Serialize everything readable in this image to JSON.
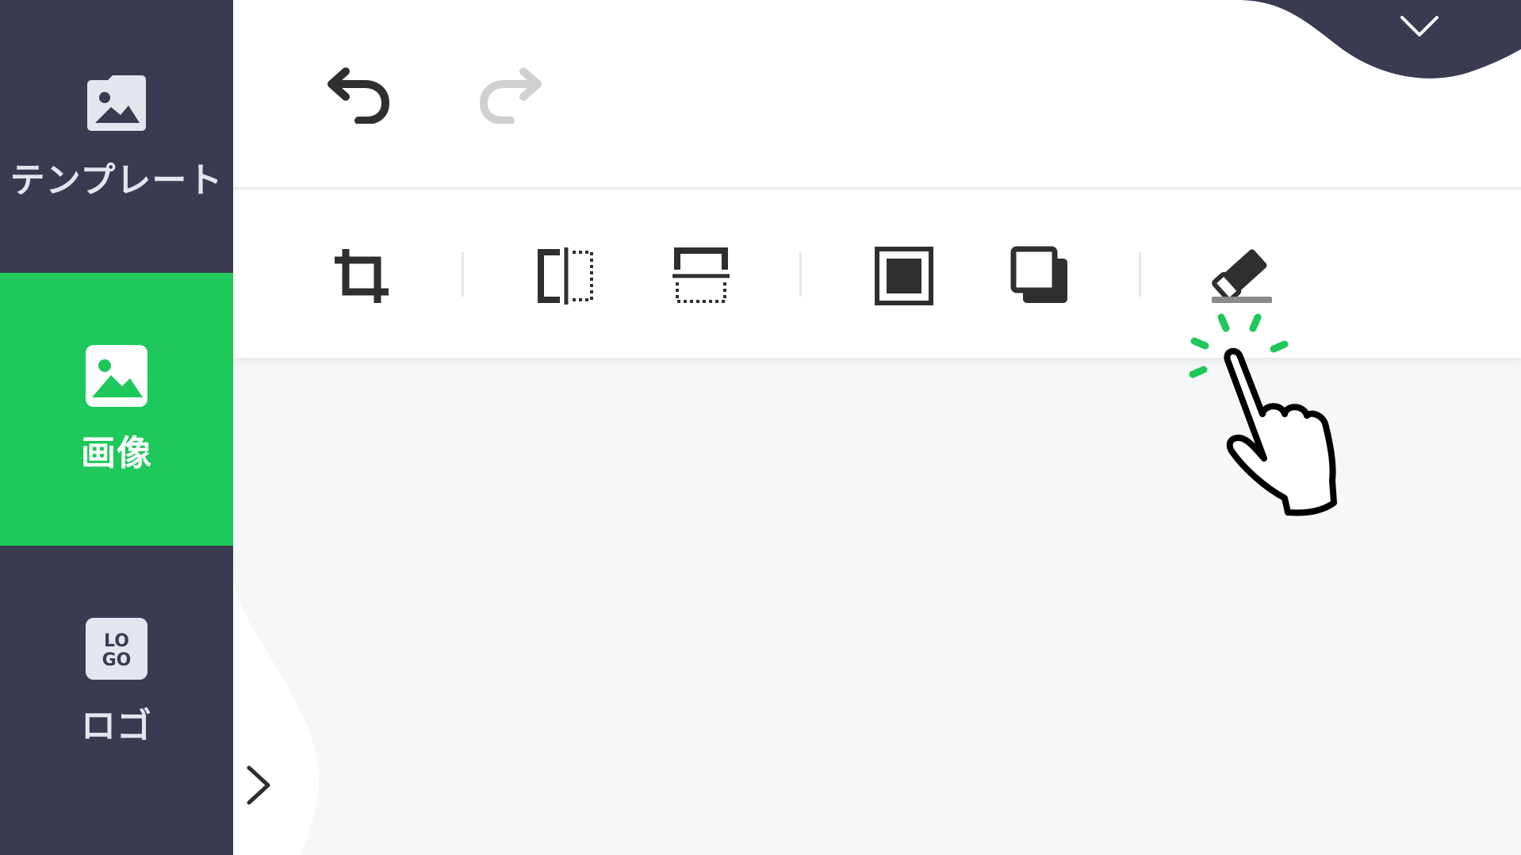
{
  "sidebar": {
    "items": [
      {
        "label": "テンプレート",
        "icon": "template-image-icon",
        "active": false
      },
      {
        "label": "画像",
        "icon": "image-icon",
        "active": true
      },
      {
        "label": "ロゴ",
        "icon": "logo-icon",
        "active": false
      }
    ],
    "logo_icon_text": [
      "LO",
      "GO"
    ]
  },
  "toolbar": {
    "history": [
      {
        "name": "undo",
        "icon": "undo-icon",
        "enabled": true
      },
      {
        "name": "redo",
        "icon": "redo-icon",
        "enabled": false
      }
    ],
    "tools": [
      {
        "name": "crop",
        "icon": "crop-icon"
      },
      {
        "name": "flip-horizontal",
        "icon": "flip-horizontal-icon"
      },
      {
        "name": "flip-vertical",
        "icon": "flip-vertical-icon"
      },
      {
        "name": "border",
        "icon": "border-frame-icon"
      },
      {
        "name": "shadow",
        "icon": "drop-shadow-icon"
      },
      {
        "name": "background-remove",
        "icon": "eraser-icon"
      }
    ]
  },
  "colors": {
    "sidebar_bg": "#3a3b51",
    "active_item": "#1ec85a",
    "icon_dark": "#2f2f2f",
    "icon_disabled": "#d0d0d0",
    "click_accent": "#1ec85a"
  },
  "decorations": {
    "collapse_toggle_icon": "chevron-down-icon",
    "expand_toggle_icon": "chevron-right-icon",
    "pointer": "hand-pointer-icon"
  }
}
